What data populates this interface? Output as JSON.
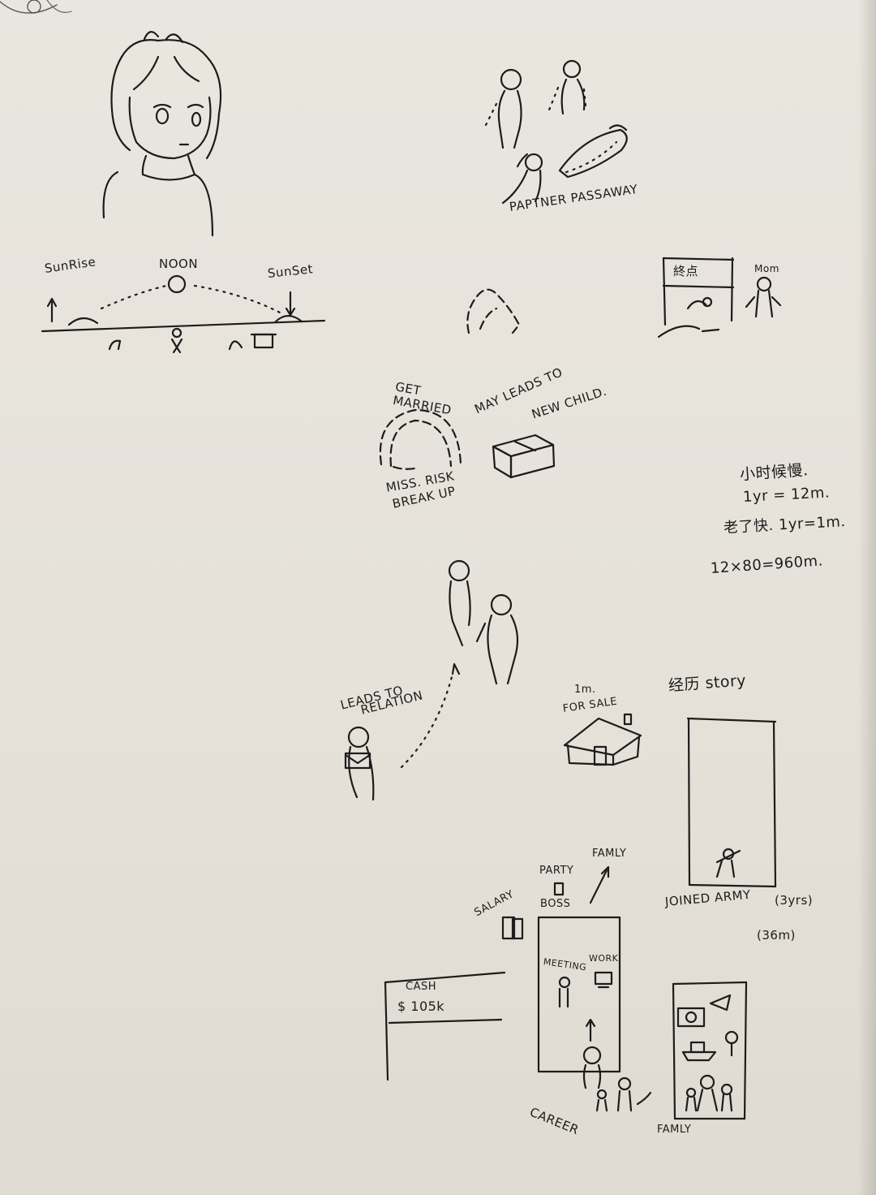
{
  "labels": {
    "sunrise": "SunRise",
    "noon": "NOON",
    "sunset": "SunSet",
    "partner_passaway": "PAPTNER PASSAWAY",
    "finish_sign": "終点",
    "mom": "Mom",
    "get_married": "GET MARRIED",
    "may_leads_to": "MAY LEADS TO",
    "new_child": "NEW CHILD.",
    "miss_risk": "MISS. RISK",
    "breakup": "BREAK UP",
    "leads_to": "LEADS TO",
    "relation": "RELATION",
    "house_price": "1m.",
    "for_sale": "FOR SALE",
    "experience_story": "经历 story",
    "joined_army": "JOINED ARMY",
    "army_years": "(3yrs)",
    "army_months": "(36m)",
    "family_top": "FAMLY",
    "party": "PARTY",
    "boss": "BOSS",
    "salary": "SALARY",
    "meeting": "MEETING",
    "work": "WORK",
    "cash_label": "CASH",
    "cash_value": "$ 105k",
    "career": "CAREER",
    "family_bottom": "FAMLY"
  },
  "notes": {
    "line1": "小时候慢.",
    "line2": "1yr = 12m.",
    "line3": "老了快. 1yr=1m.",
    "line4": "12×80=960m."
  }
}
